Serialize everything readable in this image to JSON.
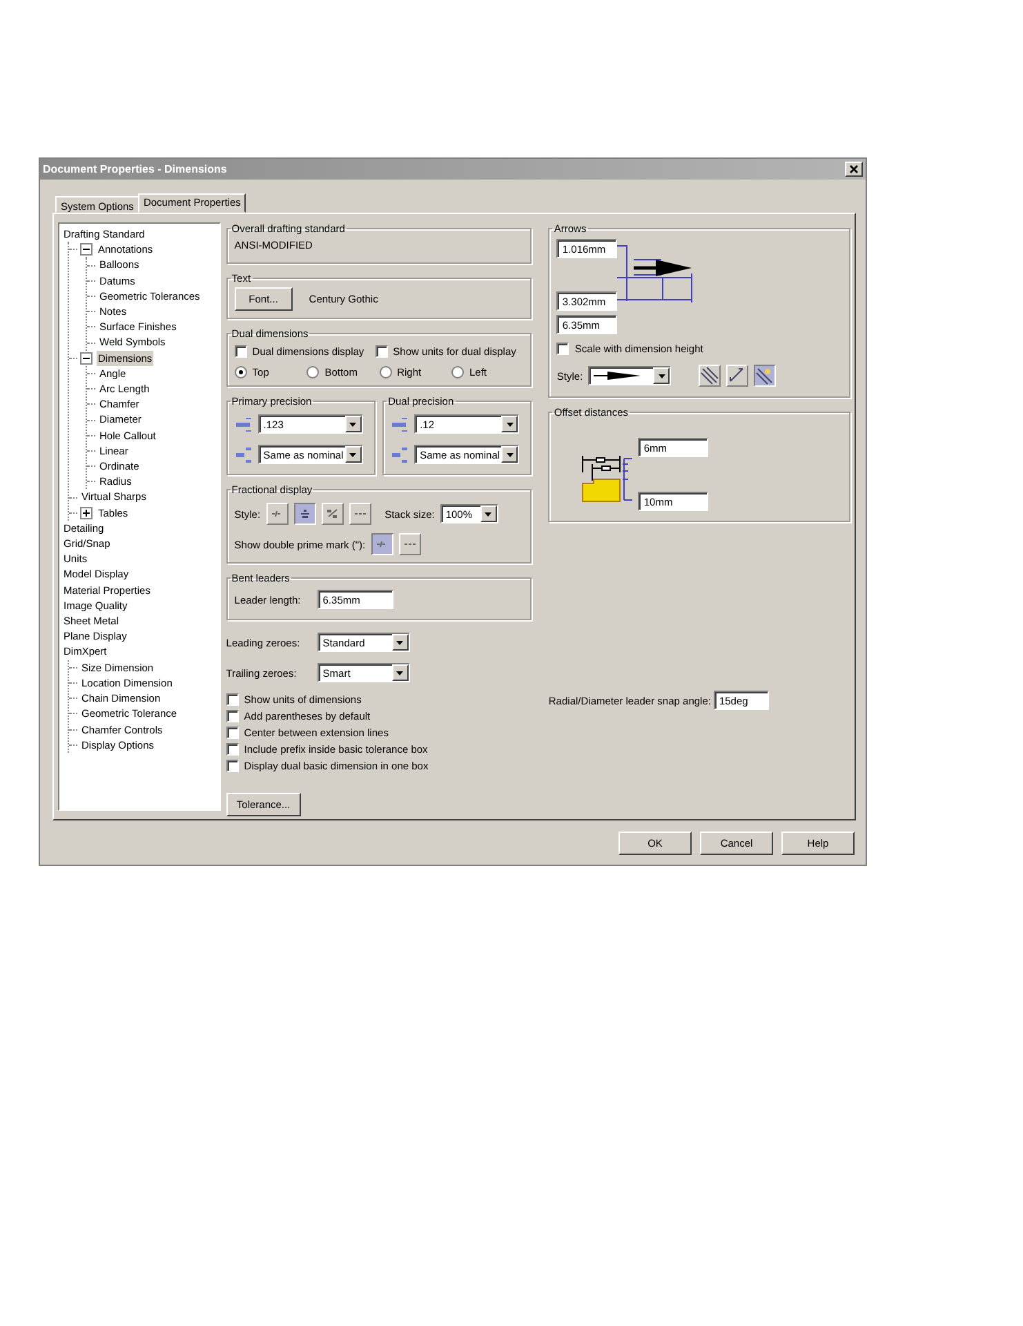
{
  "window": {
    "title": "Document Properties - Dimensions"
  },
  "tabs": [
    {
      "label": "System Options",
      "selected": false
    },
    {
      "label": "Document Properties",
      "selected": true
    }
  ],
  "tree": {
    "items": [
      {
        "label": "Drafting Standard",
        "selected": false,
        "children": [
          {
            "label": "Annotations",
            "selected": false,
            "expanded": true,
            "children": [
              {
                "label": "Balloons",
                "selected": false
              },
              {
                "label": "Datums",
                "selected": false
              },
              {
                "label": "Geometric Tolerances",
                "selected": false
              },
              {
                "label": "Notes",
                "selected": false
              },
              {
                "label": "Surface Finishes",
                "selected": false
              },
              {
                "label": "Weld Symbols",
                "selected": false
              }
            ]
          },
          {
            "label": "Dimensions",
            "selected": true,
            "expanded": true,
            "children": [
              {
                "label": "Angle",
                "selected": false
              },
              {
                "label": "Arc Length",
                "selected": false
              },
              {
                "label": "Chamfer",
                "selected": false
              },
              {
                "label": "Diameter",
                "selected": false
              },
              {
                "label": "Hole Callout",
                "selected": false
              },
              {
                "label": "Linear",
                "selected": false
              },
              {
                "label": "Ordinate",
                "selected": false
              },
              {
                "label": "Radius",
                "selected": false
              }
            ]
          },
          {
            "label": "Virtual Sharps",
            "selected": false
          },
          {
            "label": "Tables",
            "selected": false,
            "expanded": false
          }
        ]
      },
      {
        "label": "Detailing",
        "selected": false
      },
      {
        "label": "Grid/Snap",
        "selected": false
      },
      {
        "label": "Units",
        "selected": false
      },
      {
        "label": "Model Display",
        "selected": false
      },
      {
        "label": "Material Properties",
        "selected": false
      },
      {
        "label": "Image Quality",
        "selected": false
      },
      {
        "label": "Sheet Metal",
        "selected": false
      },
      {
        "label": "Plane Display",
        "selected": false
      },
      {
        "label": "DimXpert",
        "selected": false,
        "children": [
          {
            "label": "Size Dimension",
            "selected": false
          },
          {
            "label": "Location Dimension",
            "selected": false
          },
          {
            "label": "Chain Dimension",
            "selected": false
          },
          {
            "label": "Geometric Tolerance",
            "selected": false
          },
          {
            "label": "Chamfer Controls",
            "selected": false
          },
          {
            "label": "Display Options",
            "selected": false
          }
        ]
      }
    ]
  },
  "overall_standard": {
    "label": "Overall drafting standard",
    "value": "ANSI-MODIFIED"
  },
  "text": {
    "label": "Text",
    "button": "Font...",
    "font_name": "Century Gothic"
  },
  "dual_dimensions": {
    "label": "Dual dimensions",
    "checkboxes": [
      {
        "label": "Dual dimensions display",
        "checked": false
      },
      {
        "label": "Show units for dual display",
        "checked": false
      }
    ],
    "radios": [
      {
        "label": "Top",
        "selected": true
      },
      {
        "label": "Bottom",
        "selected": false
      },
      {
        "label": "Right",
        "selected": false
      },
      {
        "label": "Left",
        "selected": false
      }
    ]
  },
  "precision": [
    {
      "label": "Primary precision",
      "value": ".123",
      "tolerance_value": "Same as nominal"
    },
    {
      "label": "Dual precision",
      "value": ".12",
      "tolerance_value": "Same as nominal"
    }
  ],
  "fractional_display": {
    "label": "Fractional display",
    "style_label": "Style:",
    "styles": [
      {
        "selected": false
      },
      {
        "selected": true
      },
      {
        "selected": false
      },
      {
        "selected": false
      }
    ],
    "stack_label": "Stack size:",
    "stack_value": "100%",
    "prime_label": "Show double prime mark (\"):",
    "prime_options": [
      {
        "selected": true
      },
      {
        "selected": false
      }
    ]
  },
  "bent_leaders": {
    "label": "Bent leaders",
    "field_label": "Leader length:",
    "value": "6.35mm"
  },
  "zeroes": [
    {
      "label": "Leading zeroes:",
      "value": "Standard"
    },
    {
      "label": "Trailing zeroes:",
      "value": "Smart"
    }
  ],
  "options": [
    {
      "label": "Show units of dimensions",
      "checked": false
    },
    {
      "label": "Add parentheses by default",
      "checked": false
    },
    {
      "label": "Center between extension lines",
      "checked": false
    },
    {
      "label": "Include prefix inside basic tolerance box",
      "checked": false
    },
    {
      "label": "Display dual basic dimension in one box",
      "checked": false
    }
  ],
  "tolerance_button": "Tolerance...",
  "arrows": {
    "label": "Arrows",
    "sizes": [
      "1.016mm",
      "3.302mm",
      "6.35mm"
    ],
    "scale": {
      "label": "Scale with dimension height",
      "checked": false
    },
    "style_label": "Style:",
    "placements": [
      {
        "selected": false
      },
      {
        "selected": false
      },
      {
        "selected": true
      }
    ]
  },
  "offset": {
    "label": "Offset distances",
    "values": [
      "6mm",
      "10mm"
    ]
  },
  "snap_angle": {
    "label": "Radial/Diameter leader snap angle:",
    "value": "15deg"
  },
  "buttons": [
    "OK",
    "Cancel",
    "Help"
  ]
}
